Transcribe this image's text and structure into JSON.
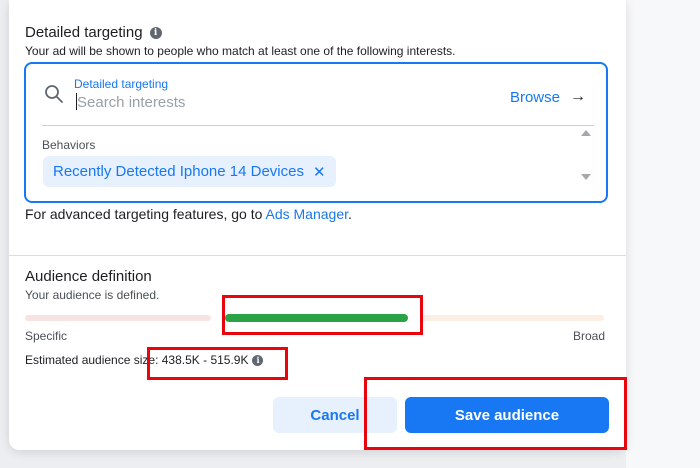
{
  "detailed_targeting": {
    "title": "Detailed targeting",
    "description": "Your ad will be shown to people who match at least one of the following interests.",
    "search": {
      "label": "Detailed targeting",
      "placeholder": "Search interests",
      "value": ""
    },
    "browse_label": "Browse",
    "behaviors_label": "Behaviors",
    "selected_items": [
      "Recently Detected Iphone 14 Devices"
    ],
    "advanced_text": "For advanced targeting features, go to ",
    "advanced_link": "Ads Manager",
    "advanced_suffix": "."
  },
  "audience_definition": {
    "title": "Audience definition",
    "status": "Your audience is defined.",
    "meter_level_fraction": 0.5,
    "specific_label": "Specific",
    "broad_label": "Broad",
    "estimated_size": "Estimated audience size: 438.5K - 515.9K"
  },
  "footer": {
    "cancel_label": "Cancel",
    "save_label": "Save audience"
  },
  "colors": {
    "accent": "#1877f2",
    "meter_good": "#2aa245",
    "annotation": "#e8050b"
  },
  "icons": [
    "info-icon",
    "search-icon",
    "arrow-right-icon",
    "close-icon",
    "scroll-up-icon",
    "scroll-down-icon"
  ]
}
